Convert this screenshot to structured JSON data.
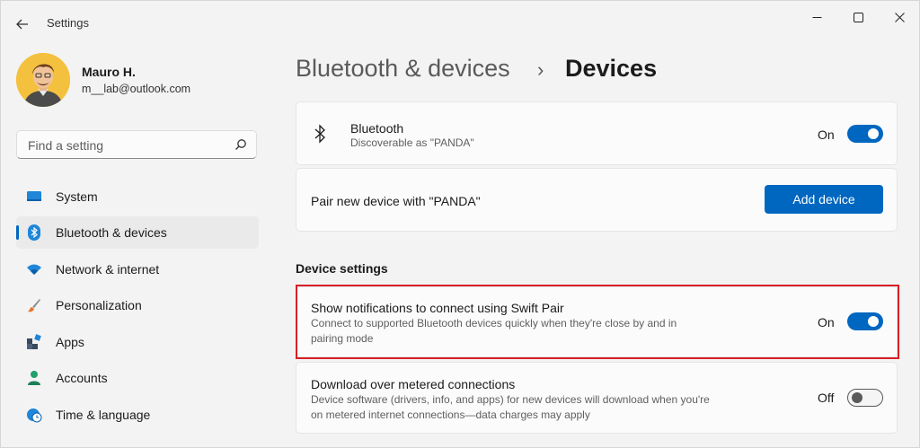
{
  "window": {
    "title": "Settings",
    "back_icon": "back-arrow-icon",
    "controls": [
      "minimize-icon",
      "maximize-icon",
      "close-icon"
    ]
  },
  "user": {
    "name": "Mauro H.",
    "email": "m__lab@outlook.com"
  },
  "search": {
    "placeholder": "Find a setting",
    "value": ""
  },
  "sidebar": {
    "items": [
      {
        "label": "System",
        "icon": "monitor-icon",
        "selected": false
      },
      {
        "label": "Bluetooth & devices",
        "icon": "bluetooth-icon",
        "selected": true
      },
      {
        "label": "Network & internet",
        "icon": "wifi-icon",
        "selected": false
      },
      {
        "label": "Personalization",
        "icon": "paintbrush-icon",
        "selected": false
      },
      {
        "label": "Apps",
        "icon": "apps-icon",
        "selected": false
      },
      {
        "label": "Accounts",
        "icon": "person-icon",
        "selected": false
      },
      {
        "label": "Time & language",
        "icon": "globe-clock-icon",
        "selected": false
      }
    ]
  },
  "breadcrumb": {
    "parent": "Bluetooth & devices",
    "separator": "›",
    "current": "Devices"
  },
  "bluetooth_card": {
    "title": "Bluetooth",
    "subtitle": "Discoverable as \"PANDA\"",
    "state": "On"
  },
  "pair_card": {
    "title": "Pair new device with \"PANDA\"",
    "button": "Add device"
  },
  "device_settings": {
    "heading": "Device settings",
    "swift_pair": {
      "title": "Show notifications to connect using Swift Pair",
      "subtitle_line1": "Connect to supported Bluetooth devices quickly when they're close by and in",
      "subtitle_line2": "pairing mode",
      "state": "On"
    },
    "metered": {
      "title": "Download over metered connections",
      "subtitle_line1": "Device software (drivers, info, and apps) for new devices will download when you're",
      "subtitle_line2": "on metered internet connections—data charges may apply",
      "state": "Off"
    }
  },
  "colors": {
    "accent": "#0067c0",
    "highlight_border": "#d81f26"
  }
}
